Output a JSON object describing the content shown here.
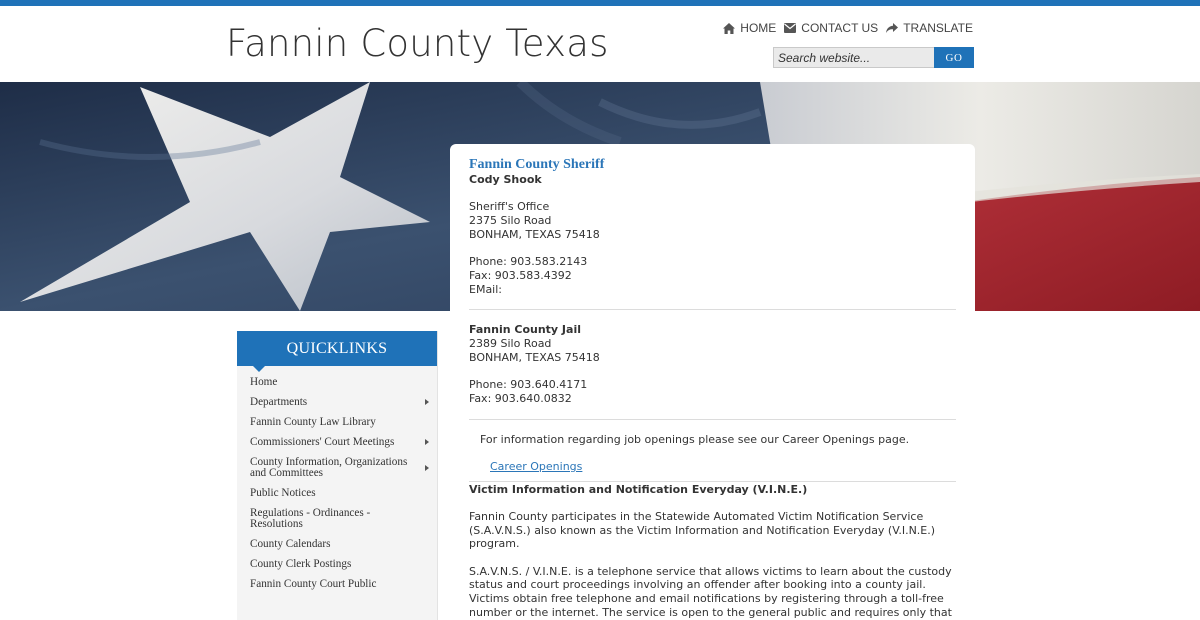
{
  "site": {
    "title": "Fannin County Texas"
  },
  "topnav": {
    "home": "HOME",
    "contact": "CONTACT US",
    "translate": "TRANSLATE"
  },
  "search": {
    "placeholder": "Search website...",
    "go": "GO"
  },
  "colors": {
    "brand_blue": "#1f72b8",
    "link_blue": "#2b76b8",
    "sidebar_bg": "#f4f4f4"
  },
  "sheriff": {
    "title": "Fannin County Sheriff",
    "name": "Cody Shook",
    "office": "Sheriff's Office",
    "street": "2375 Silo Road",
    "city": "BONHAM, TEXAS  75418",
    "phone": "Phone: 903.583.2143",
    "fax": "Fax: 903.583.4392",
    "email": "EMail:"
  },
  "jail": {
    "title": "Fannin County Jail",
    "street": "2389 Silo Road",
    "city": "BONHAM, TEXAS  75418",
    "phone": "Phone: 903.640.4171",
    "fax": "Fax: 903.640.0832"
  },
  "careers": {
    "text": "For information regarding job openings please see our Career Openings page.",
    "link": "Career Openings"
  },
  "vine": {
    "heading": "Victim Information and Notification Everyday (V.I.N.E.)",
    "p1": "Fannin County participates in the Statewide Automated Victim Notification Service (S.A.V.N.S.) also known as the Victim Information and Notification Everyday (V.I.N.E.) program.",
    "p2": "S.A.V.N.S. / V.I.N.E. is a telephone service that allows victims to learn about the custody status and court proceedings involving an offender after booking into a county jail.  Victims obtain free telephone and email notifications by registering through a toll-free number or the internet.  The service is open to the general public and requires only that an individual provide an inmate's full name or jail-assigned"
  },
  "quicklinks": {
    "title": "QUICKLINKS",
    "items": [
      {
        "label": "Home",
        "submenu": false
      },
      {
        "label": "Departments",
        "submenu": true
      },
      {
        "label": "Fannin County Law Library",
        "submenu": false
      },
      {
        "label": "Commissioners' Court Meetings",
        "submenu": true
      },
      {
        "label": "County Information, Organizations and Committees",
        "submenu": true
      },
      {
        "label": "Public Notices",
        "submenu": false
      },
      {
        "label": "Regulations - Ordinances - Resolutions",
        "submenu": false
      },
      {
        "label": "County Calendars",
        "submenu": false
      },
      {
        "label": "County Clerk Postings",
        "submenu": false
      },
      {
        "label": "Fannin County Court Public",
        "submenu": false
      }
    ]
  }
}
